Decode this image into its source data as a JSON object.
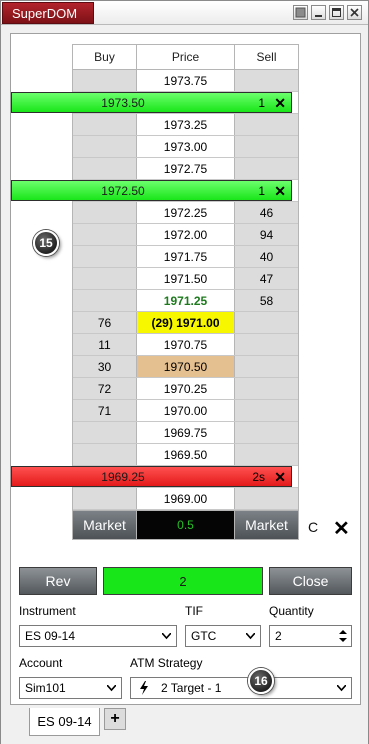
{
  "window": {
    "title": "SuperDOM"
  },
  "ladder": {
    "headers": {
      "buy": "Buy",
      "price": "Price",
      "sell": "Sell"
    },
    "rows": [
      {
        "type": "level",
        "price": "1973.75",
        "buy": "",
        "sell": ""
      },
      {
        "type": "order",
        "price": "1973.50",
        "qty": "1",
        "color": "green"
      },
      {
        "type": "level",
        "price": "1973.25",
        "buy": "",
        "sell": ""
      },
      {
        "type": "level",
        "price": "1973.00",
        "buy": "",
        "sell": ""
      },
      {
        "type": "level",
        "price": "1972.75",
        "buy": "",
        "sell": ""
      },
      {
        "type": "order",
        "price": "1972.50",
        "qty": "1",
        "color": "green"
      },
      {
        "type": "level",
        "price": "1972.25",
        "buy": "",
        "sell": "46"
      },
      {
        "type": "level",
        "price": "1972.00",
        "buy": "",
        "sell": "94"
      },
      {
        "type": "level",
        "price": "1971.75",
        "buy": "",
        "sell": "40"
      },
      {
        "type": "level",
        "price": "1971.50",
        "buy": "",
        "sell": "47"
      },
      {
        "type": "level",
        "price": "1971.25",
        "buy": "",
        "sell": "58",
        "style": "last"
      },
      {
        "type": "level",
        "price": "(29) 1971.00",
        "buy": "76",
        "sell": "",
        "style": "inside"
      },
      {
        "type": "level",
        "price": "1970.75",
        "buy": "11",
        "sell": ""
      },
      {
        "type": "level",
        "price": "1970.50",
        "buy": "30",
        "sell": "",
        "style": "tan"
      },
      {
        "type": "level",
        "price": "1970.25",
        "buy": "72",
        "sell": ""
      },
      {
        "type": "level",
        "price": "1970.00",
        "buy": "71",
        "sell": ""
      },
      {
        "type": "level",
        "price": "1969.75",
        "buy": "",
        "sell": ""
      },
      {
        "type": "level",
        "price": "1969.50",
        "buy": "",
        "sell": ""
      },
      {
        "type": "order",
        "price": "1969.25",
        "qty": "2s",
        "color": "red"
      },
      {
        "type": "level",
        "price": "1969.00",
        "buy": "",
        "sell": ""
      }
    ],
    "market_buy_label": "Market",
    "pnl": "0.5",
    "market_sell_label": "Market",
    "center_label": "C"
  },
  "badges": {
    "ladder_callout": "15",
    "atm_callout": "16"
  },
  "controls": {
    "reverse_label": "Rev",
    "position_qty": "2",
    "close_label": "Close"
  },
  "fields": {
    "instrument_label": "Instrument",
    "instrument_value": "ES 09-14",
    "tif_label": "TIF",
    "tif_value": "GTC",
    "quantity_label": "Quantity",
    "quantity_value": "2",
    "account_label": "Account",
    "account_value": "Sim101",
    "atm_label": "ATM Strategy",
    "atm_value": "2 Target - 1"
  },
  "tabs": {
    "active": "ES 09-14",
    "add": "+"
  },
  "colors": {
    "title_tab": "#a01c24",
    "order_green": "#19e619",
    "order_red": "#e41a1a",
    "last_price_text": "#1d7a1d",
    "inside_ask_bg": "#f7f700",
    "highlight_tan": "#e4bf90"
  }
}
